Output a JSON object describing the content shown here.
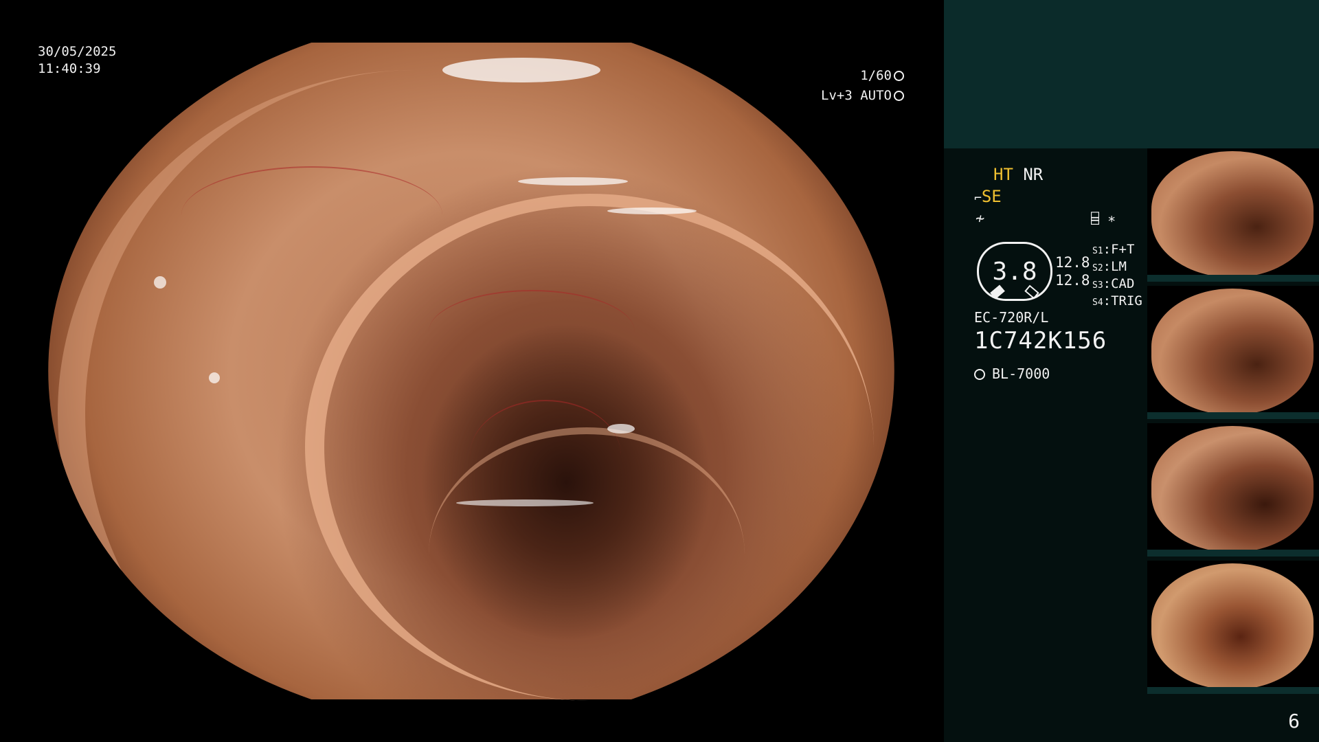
{
  "overlay": {
    "date": "30/05/2025",
    "time": "11:40:39",
    "shutter": "1/60",
    "level": "Lv+3 AUTO"
  },
  "panel": {
    "ht": "HT",
    "nr": "NR",
    "se": "SE",
    "f_icon": "≁",
    "mode_icons": "⌸ ∗",
    "gauge_value": "3.8",
    "num_a": "12.8",
    "num_b": "12.8",
    "switches": [
      {
        "key": "S1",
        "value": "F+T"
      },
      {
        "key": "S2",
        "value": "LM"
      },
      {
        "key": "S3",
        "value": "CAD"
      },
      {
        "key": "S4",
        "value": "TRIG"
      }
    ],
    "scope_model": "EC-720R/L",
    "scope_serial": "1C742K156",
    "light_source": "BL-7000"
  },
  "thumbnails": [
    {
      "name": "capture-1"
    },
    {
      "name": "capture-2"
    },
    {
      "name": "capture-3"
    },
    {
      "name": "capture-4"
    }
  ],
  "page_number": "6",
  "colors": {
    "panel_bg": "#04100f",
    "panel_header": "#0b2b2a",
    "accent_yellow": "#f0c030",
    "text_white": "#f2f2f2"
  }
}
